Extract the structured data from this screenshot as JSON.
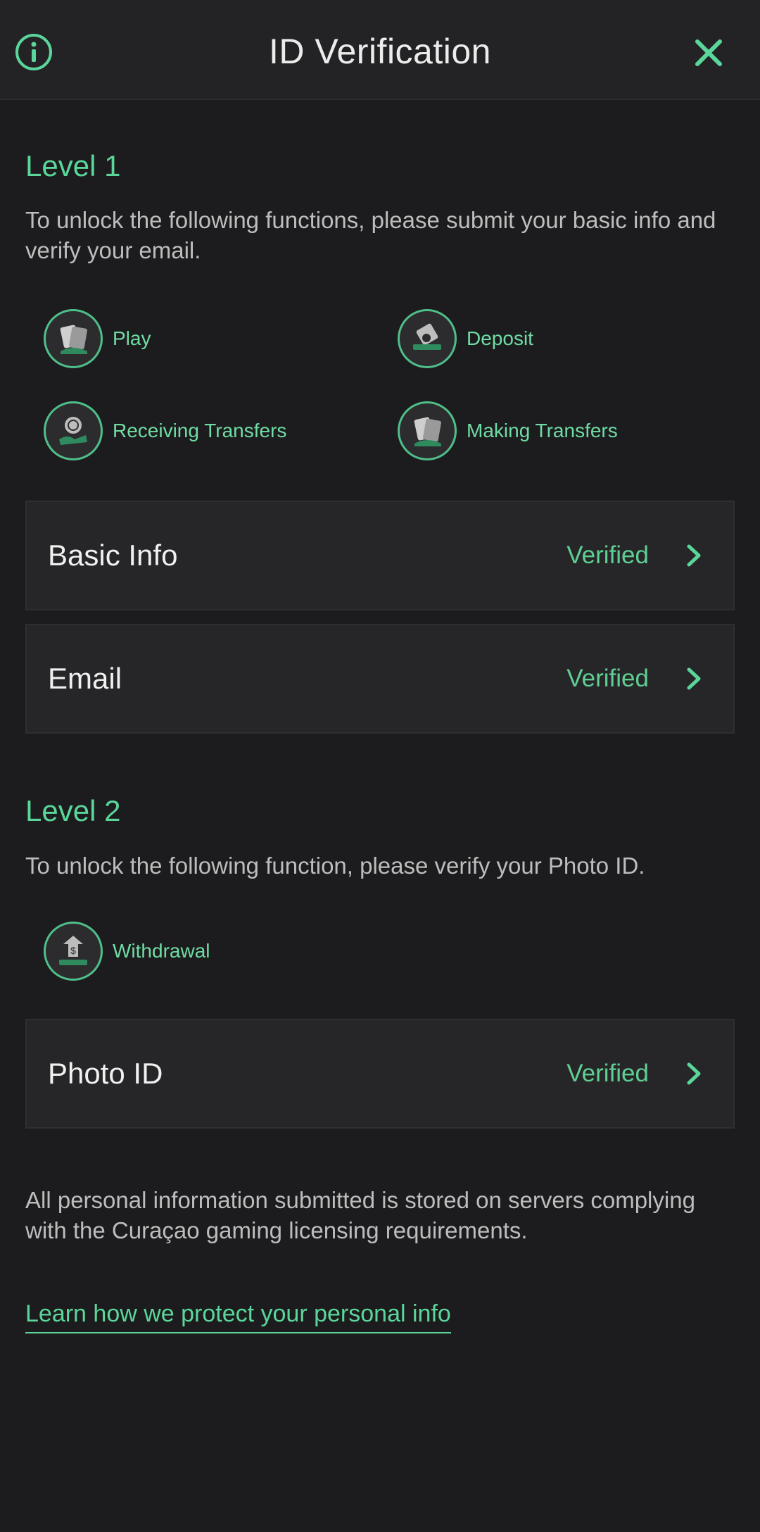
{
  "header": {
    "title": "ID Verification",
    "info_icon": "info-circle-icon",
    "close_icon": "close-x-icon"
  },
  "level1": {
    "title": "Level 1",
    "description": "To unlock the following functions, please submit your basic info and verify your email.",
    "features": [
      {
        "label": "Play",
        "icon": "playing-cards-icon"
      },
      {
        "label": "Deposit",
        "icon": "deposit-tray-icon"
      },
      {
        "label": "Receiving Transfers",
        "icon": "coin-hand-icon"
      },
      {
        "label": "Making Transfers",
        "icon": "playing-cards-icon"
      }
    ],
    "rows": [
      {
        "label": "Basic Info",
        "status": "Verified"
      },
      {
        "label": "Email",
        "status": "Verified"
      }
    ]
  },
  "level2": {
    "title": "Level 2",
    "description": "To unlock the following function, please verify your Photo ID.",
    "features": [
      {
        "label": "Withdrawal",
        "icon": "withdraw-arrow-icon"
      }
    ],
    "rows": [
      {
        "label": "Photo ID",
        "status": "Verified"
      }
    ]
  },
  "footer": {
    "note": "All personal information submitted is stored on servers complying with the Curaçao gaming licensing requirements.",
    "link": "Learn how we protect your personal info"
  },
  "colors": {
    "accent": "#5bd69a",
    "background": "#1c1c1e",
    "row_background": "#262628"
  }
}
